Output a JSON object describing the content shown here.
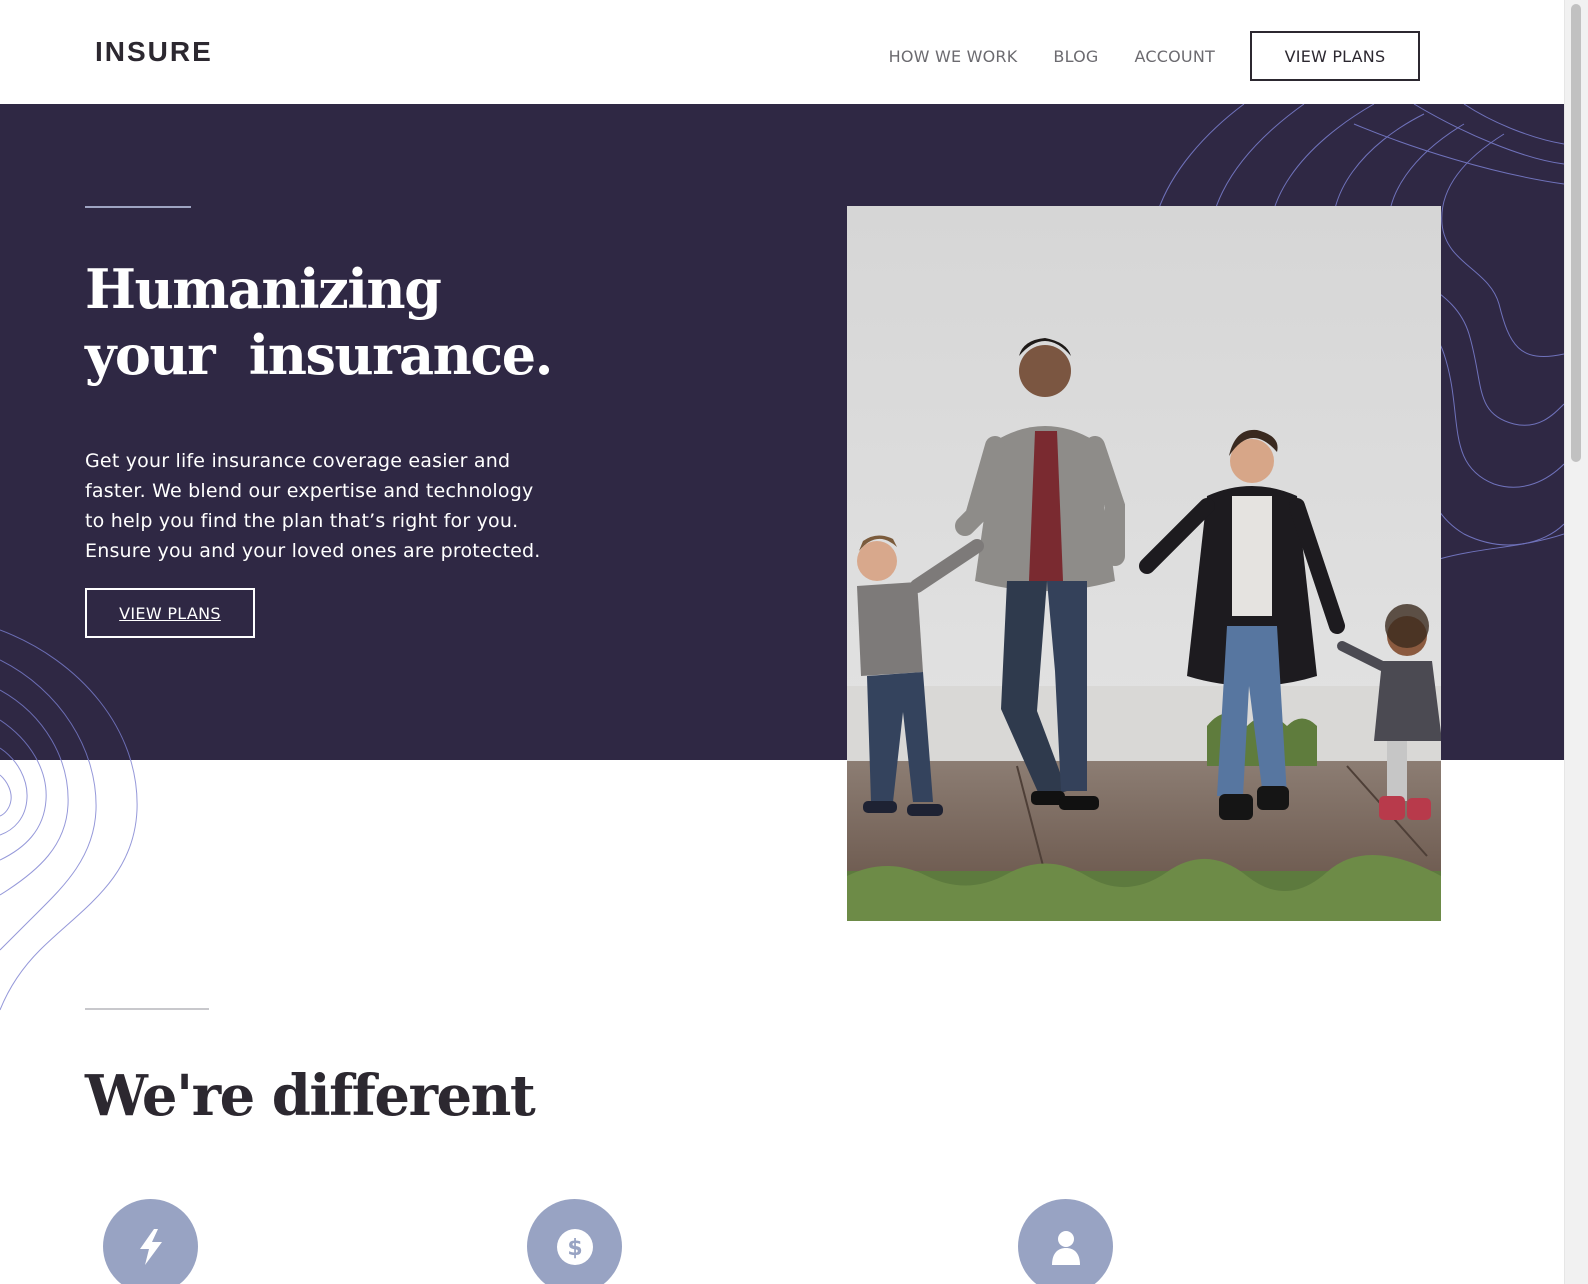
{
  "header": {
    "logo": "INSURE",
    "nav": [
      "HOW WE WORK",
      "BLOG",
      "ACCOUNT"
    ],
    "cta": "VIEW PLANS"
  },
  "hero": {
    "title_line1": "Humanizing",
    "title_line2": "your  insurance.",
    "text": "Get your life insurance coverage easier and faster. We blend our expertise and technology to help you find the plan that’s right for you. Ensure you and your loved ones are protected.",
    "cta": "VIEW PLANS"
  },
  "different": {
    "title": "We're different",
    "features": [
      {
        "icon": "lightning-icon"
      },
      {
        "icon": "dollar-icon"
      },
      {
        "icon": "person-icon"
      }
    ]
  },
  "colors": {
    "hero_bg": "#2f2844",
    "accent": "#98a3c3",
    "dark_text": "#2c2830",
    "nav_text": "#6c6b70"
  }
}
